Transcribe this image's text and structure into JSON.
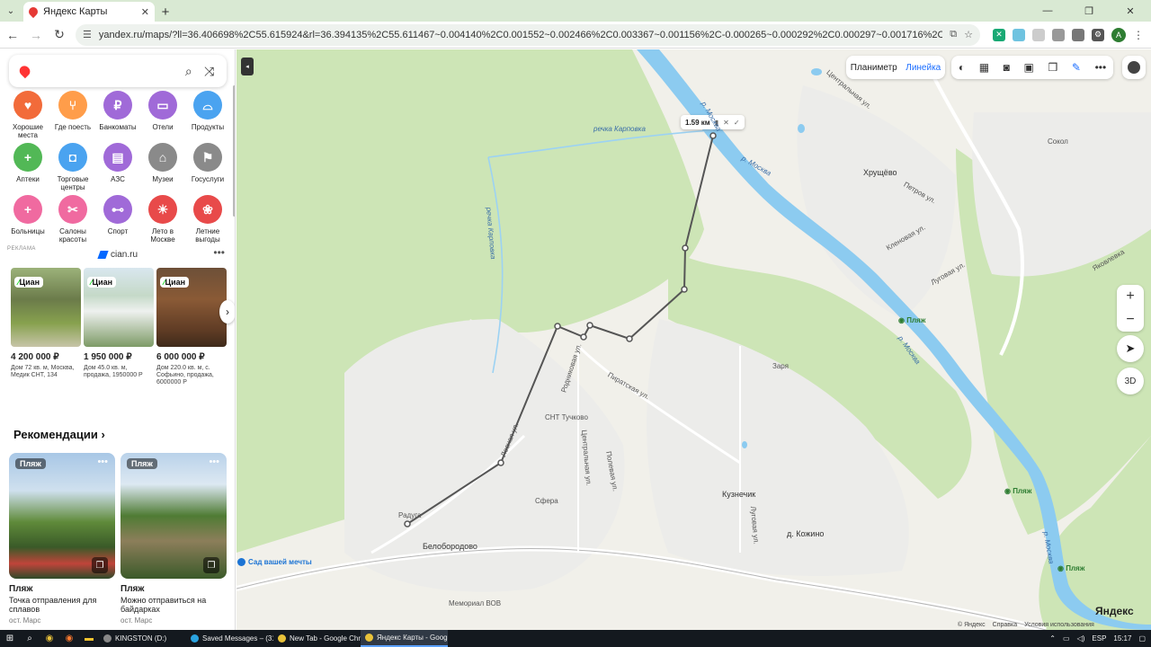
{
  "browser": {
    "tab_title": "Яндекс Карты",
    "url": "yandex.ru/maps/?ll=36.406698%2C55.615924&rl=36.394135%2C55.611467~0.004140%2C0.001552~0.002466%2C0.003367~0.001156%2C-0.000265~0.000292%2C0.000297~0.001716%2C-0.000354~0.002395%2C0.001230~0.000028%2C0.0..."
  },
  "search": {
    "placeholder": ""
  },
  "categories": [
    {
      "label": "Хорошие места",
      "icon": "heart-pin-icon",
      "color": "#f26b3a"
    },
    {
      "label": "Где поесть",
      "icon": "fork-knife-icon",
      "color": "#ff9d4a"
    },
    {
      "label": "Банкоматы",
      "icon": "ruble-icon",
      "color": "#a06ad8"
    },
    {
      "label": "Отели",
      "icon": "bed-icon",
      "color": "#a06ad8"
    },
    {
      "label": "Продукты",
      "icon": "basket-icon",
      "color": "#4aa3f0"
    },
    {
      "label": "Аптеки",
      "icon": "cross-icon",
      "color": "#52b856"
    },
    {
      "label": "Торговые центры",
      "icon": "bag-icon",
      "color": "#4aa3f0"
    },
    {
      "label": "АЗС",
      "icon": "fuel-icon",
      "color": "#a06ad8"
    },
    {
      "label": "Музеи",
      "icon": "museum-icon",
      "color": "#8a8a8a"
    },
    {
      "label": "Госуслуги",
      "icon": "flag-icon",
      "color": "#8a8a8a"
    },
    {
      "label": "Больницы",
      "icon": "plus-icon",
      "color": "#f06aa0"
    },
    {
      "label": "Салоны красоты",
      "icon": "scissors-icon",
      "color": "#f06aa0"
    },
    {
      "label": "Спорт",
      "icon": "dumbbell-icon",
      "color": "#a06ad8"
    },
    {
      "label": "Лето в Москве",
      "icon": "summer-icon",
      "color": "#e84a4a"
    },
    {
      "label": "Летние выгоды",
      "icon": "gift-icon",
      "color": "#e84a4a"
    }
  ],
  "ad": {
    "tag": "РЕКЛАМА",
    "site": "cian.ru",
    "badge": "Циан",
    "cards": [
      {
        "price": "4 200 000 ₽",
        "desc": "Дом 72 кв. м, Москва, Медик СНТ, 134"
      },
      {
        "price": "1 950 000 ₽",
        "desc": "Дом 45.0 кв. м, продажа, 1950000 Р"
      },
      {
        "price": "6 000 000 ₽",
        "desc": "Дом 220.0 кв. м, с. Софьино, продажа, 6000000 Р"
      }
    ]
  },
  "recommendations": {
    "title": "Рекомендации",
    "cards": [
      {
        "tag": "Пляж",
        "type": "Пляж",
        "name": "Точка отправления для сплавов",
        "stop": "ост. Марс"
      },
      {
        "tag": "Пляж",
        "type": "Пляж",
        "name": "Можно отправиться на байдарках",
        "stop": "ост. Марс"
      }
    ]
  },
  "map": {
    "mode_plan": "Планиметр",
    "mode_ruler": "Линейка",
    "ruler_distance": "1.59 км",
    "zoom_in": "+",
    "zoom_out": "−",
    "btn_3d": "3D",
    "logo": "Яндекс",
    "dream": "Сад вашей мечты",
    "attr": [
      "© Яндекс",
      "Справка",
      "Условия использования"
    ],
    "labels": {
      "river1": "речка Карповка",
      "river2": "речка Карповка",
      "moskva1": "р. Москва",
      "moskva2": "р. Москва",
      "moskva3": "р. Москва",
      "moskva4": "р. Москва",
      "village1": "Хрущёво",
      "village2": "СНТ Тучково",
      "village3": "Сфера",
      "village4": "Белобородово",
      "village5": "Кузнечик",
      "village6": "д. Кожино",
      "village7": "Мемориал ВОВ",
      "village8": "Заря",
      "village9": "Радуга",
      "village10": "Сокол",
      "beach1": "Пляж",
      "beach2": "Пляж",
      "beach3": "Пляж",
      "street1": "Лесная ул.",
      "street2": "Родниковая ул.",
      "street3": "Центральная ул.",
      "street4": "Полевая ул.",
      "street5": "Пиратская ул.",
      "street6": "Луговая ул.",
      "street7": "Центральная ул.",
      "street8": "Петров ул.",
      "street9": "Луговая ул.",
      "street10": "Кленовая ул.",
      "street11": "Яковлевка"
    }
  },
  "taskbar": {
    "apps": [
      "KINGSTON (D:)",
      "Saved Messages – (31...",
      "New Tab - Google Chr...",
      "Яндекс Карты - Goog..."
    ],
    "lang": "ESP",
    "time": "15:17"
  }
}
